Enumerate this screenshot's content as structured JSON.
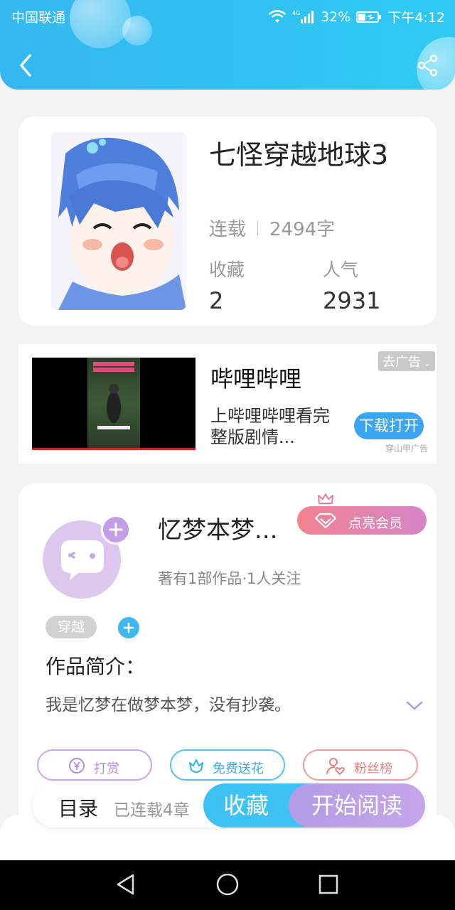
{
  "status_bar": {
    "carrier": "中国联通",
    "network": "4G",
    "battery": "32%",
    "time": "下午4:12"
  },
  "book": {
    "title": "七怪穿越地球3",
    "status": "连载",
    "word_count": "2494字",
    "favorites_label": "收藏",
    "favorites_value": "2",
    "popularity_label": "人气",
    "popularity_value": "2931"
  },
  "ad": {
    "title": "哔哩哔哩",
    "description": "上哔哩哔哩看完整版剧情...",
    "close_label": "去广告",
    "download_label": "下载打开",
    "source": "穿山甲广告"
  },
  "author": {
    "name": "忆梦本梦...",
    "vip_label": "点亮会员",
    "stats": "著有1部作品·1人关注",
    "tag": "穿越",
    "intro_heading": "作品简介：",
    "intro_text": "我是忆梦在做梦本梦，没有抄袭。",
    "actions": {
      "tip": "打赏",
      "flower": "免费送花",
      "fans": "粉丝榜"
    }
  },
  "bottom_bar": {
    "toc_label": "目录",
    "toc_status": "已连载4章",
    "favorite_button": "收藏",
    "read_button": "开始阅读"
  },
  "icons": [
    "back-icon",
    "share-icon",
    "wifi-icon",
    "signal-icon",
    "battery-icon",
    "crown-icon",
    "diamond-icon",
    "plus-icon",
    "chevron-down-icon",
    "yen-icon",
    "flower-icon",
    "user-heart-icon",
    "nav-back-icon",
    "nav-home-icon",
    "nav-recent-icon"
  ],
  "colors": {
    "header": "#35b7f1",
    "accent_blue": "#3ec2f4",
    "accent_purple": "#b19ce6",
    "vip_pink": "#f2838f"
  }
}
